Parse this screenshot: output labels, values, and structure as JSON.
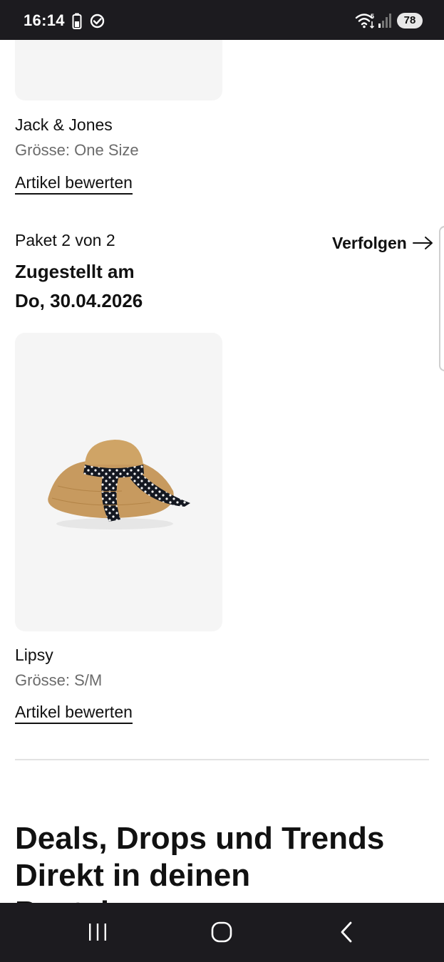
{
  "status_bar": {
    "time": "16:14",
    "battery_level": "78",
    "icons": [
      "battery-saver-icon",
      "check-circle-icon",
      "wifi-icon",
      "signal-icon"
    ]
  },
  "items": [
    {
      "brand": "Jack & Jones",
      "size": "Grösse: One Size",
      "rate_label": "Artikel bewerten"
    },
    {
      "brand": "Lipsy",
      "size": "Grösse: S/M",
      "rate_label": "Artikel bewerten"
    }
  ],
  "package": {
    "label": "Paket 2 von 2",
    "status_line1": "Zugestellt am",
    "status_line2": "Do, 30.04.2026",
    "track_label": "Verfolgen"
  },
  "promo": {
    "line1": "Deals, Drops und Trends",
    "line2": "Direkt in deinen",
    "line3": "Posteingang"
  },
  "colors": {
    "system_bar": "#1c1b1f",
    "card_bg": "#f5f5f5",
    "text": "#111111",
    "muted_text": "#6b6b6b"
  },
  "nav_icons": [
    "recent-apps-icon",
    "home-icon",
    "back-icon"
  ]
}
